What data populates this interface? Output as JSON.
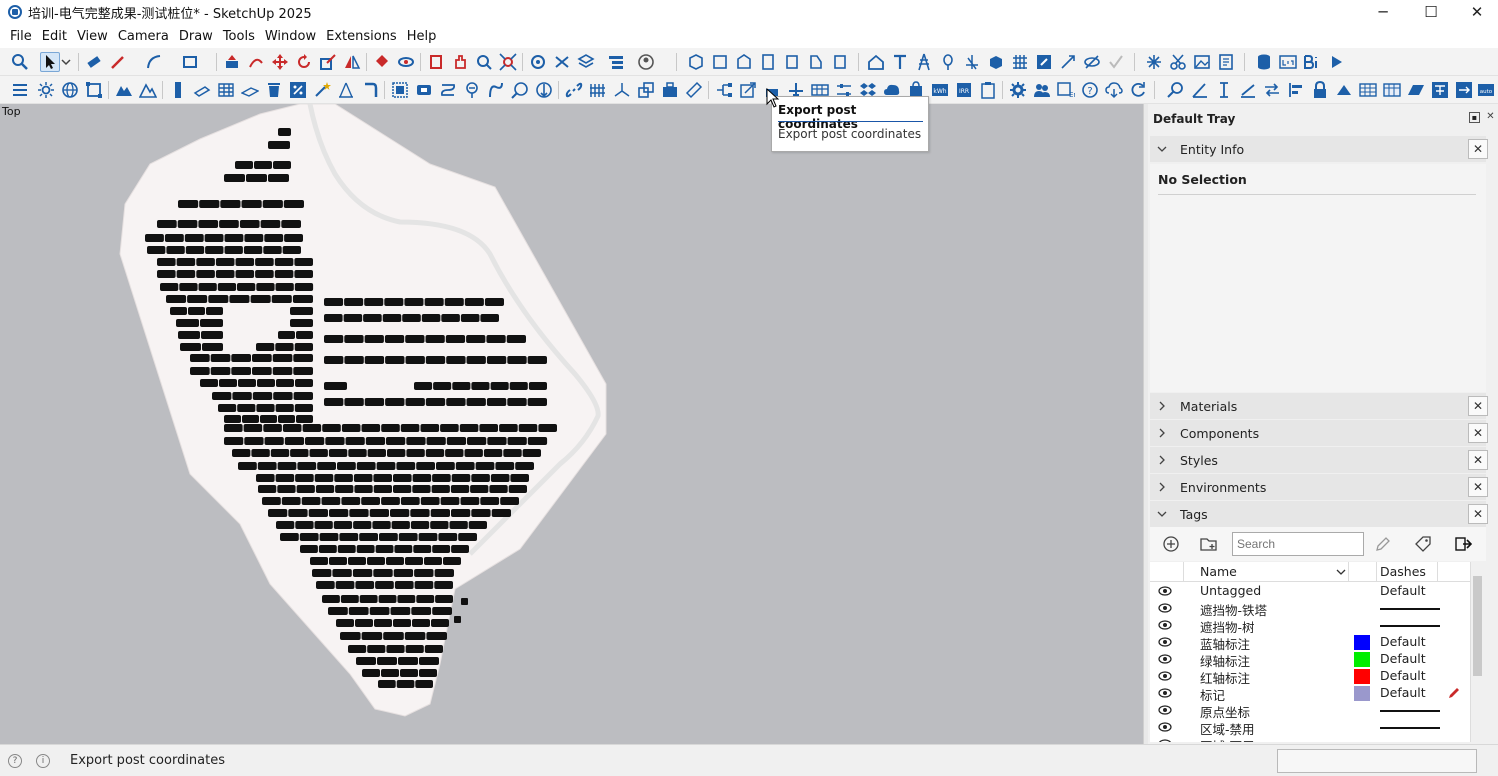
{
  "window": {
    "title": "培训-电气完整成果-测试桩位* - SketchUp 2025",
    "minimize": "─",
    "maximize": "☐",
    "close": "✕"
  },
  "menu": [
    "File",
    "Edit",
    "View",
    "Camera",
    "Draw",
    "Tools",
    "Window",
    "Extensions",
    "Help"
  ],
  "viewport": {
    "view_label": "Top"
  },
  "tooltip": {
    "title": "Export post coordinates",
    "description": "Export post coordinates"
  },
  "tray": {
    "title": "Default Tray",
    "entity_info": {
      "label": "Entity Info",
      "selection": "No Selection"
    },
    "panels": [
      "Materials",
      "Components",
      "Styles",
      "Environments"
    ],
    "tags": {
      "label": "Tags",
      "search_placeholder": "Search",
      "columns": {
        "name": "Name",
        "dashes": "Dashes"
      },
      "rows": [
        {
          "name": "Untagged",
          "dashes": "Default",
          "color": null
        },
        {
          "name": "遮挡物-铁塔",
          "dashes": "",
          "color": null
        },
        {
          "name": "遮挡物-树",
          "dashes": "",
          "color": null
        },
        {
          "name": "蓝轴标注",
          "dashes": "Default",
          "color": "#0000ff"
        },
        {
          "name": "绿轴标注",
          "dashes": "Default",
          "color": "#00ee00"
        },
        {
          "name": "红轴标注",
          "dashes": "Default",
          "color": "#ff0000"
        },
        {
          "name": "标记",
          "dashes": "Default",
          "color": "#9a98cc"
        },
        {
          "name": "原点坐标",
          "dashes": "",
          "color": null
        },
        {
          "name": "区域-禁用",
          "dashes": "",
          "color": null
        },
        {
          "name": "区域-可用",
          "dashes": "",
          "color": null
        }
      ]
    }
  },
  "status": {
    "message": "Export post coordinates"
  },
  "colors": {
    "accent": "#1d5fa8",
    "viewport_bg": "#bcbdc1",
    "site": "#f7f3f3",
    "panels": "#111111"
  }
}
